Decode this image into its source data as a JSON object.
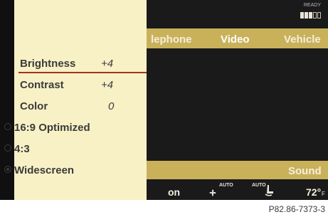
{
  "header": {
    "menu": [
      "lephone",
      "Video",
      "Vehicle"
    ],
    "status_label": "READY",
    "signal_bars": {
      "filled": 3,
      "total": 5
    }
  },
  "video_menu": {
    "items": [
      {
        "label": "Brightness",
        "value": "+4"
      },
      {
        "label": "Contrast",
        "value": "+4"
      },
      {
        "label": "Color",
        "value": "0"
      }
    ],
    "aspect_options": [
      {
        "label": "16:9 Optimized",
        "selected": false
      },
      {
        "label": "4:3",
        "selected": false
      },
      {
        "label": "Widescreen",
        "selected": true
      }
    ]
  },
  "lower_bar": {
    "sound_label": "Sound"
  },
  "climate": {
    "state": "on",
    "fan_auto": "AUTO",
    "seat_auto": "AUTO",
    "temperature": "72°",
    "unit": "F"
  },
  "caption": "P82.86-7373-3",
  "colors": {
    "menu_bar": "#c9b15a",
    "panel_bg": "#f8f1c6",
    "selection_line": "#a6301f",
    "screen_bg": "#1a1a1b"
  }
}
